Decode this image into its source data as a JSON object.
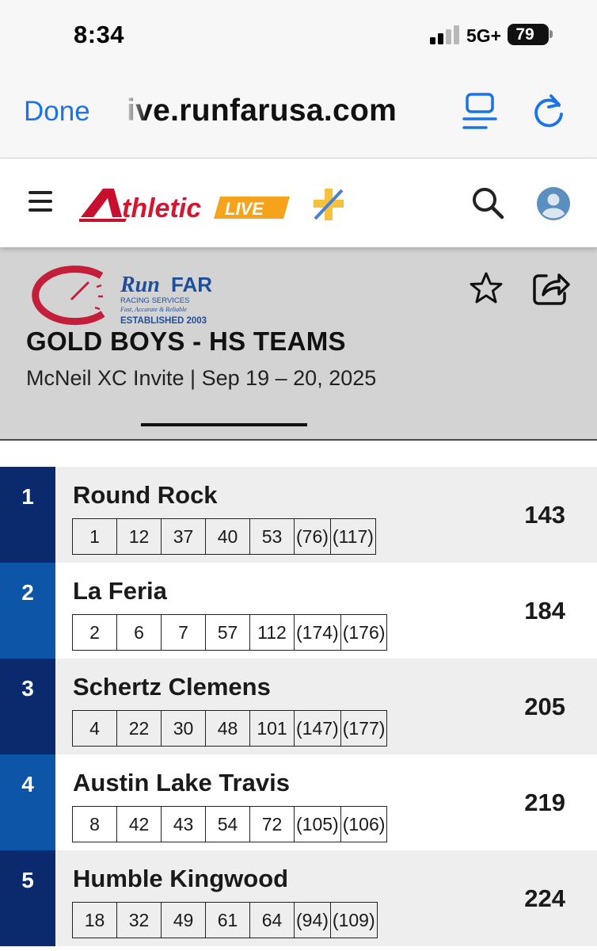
{
  "status_bar": {
    "time": "8:34",
    "network": "5G+",
    "battery": "79"
  },
  "browser": {
    "done_label": "Done",
    "url": "ive.runfarusa.com",
    "icons": {
      "reader": "reader-view-icon",
      "reload": "reload-icon"
    }
  },
  "site_header": {
    "logo_main": "thletic",
    "logo_badge": "LIVE",
    "icons": {
      "menu": "hamburger-menu-icon",
      "search": "search-icon",
      "account": "user-avatar-icon",
      "plus": "plus-icon"
    }
  },
  "meet": {
    "logo": {
      "name_run": "Run",
      "name_far": "FAR",
      "tagline": "RACING SERVICES",
      "motto": "Fast, Accurate & Reliable",
      "established": "ESTABLISHED 2003"
    },
    "event_title": "GOLD BOYS - HS TEAMS",
    "subtitle": "McNeil XC Invite | Sep 19 – 20, 2025",
    "icons": {
      "favorite": "star-icon",
      "share": "share-icon"
    }
  },
  "colors": {
    "rank_dark": "#0b2a6e",
    "rank_mid": "#0d55a6",
    "link_blue": "#1a73e8",
    "athletic_red": "#c8102e",
    "athletic_orange": "#f7a21b"
  },
  "results": [
    {
      "rank": "1",
      "team": "Round Rock",
      "scorers": [
        "1",
        "12",
        "37",
        "40",
        "53",
        "(76)",
        "(117)"
      ],
      "score": "143"
    },
    {
      "rank": "2",
      "team": "La Feria",
      "scorers": [
        "2",
        "6",
        "7",
        "57",
        "112",
        "(174)",
        "(176)"
      ],
      "score": "184"
    },
    {
      "rank": "3",
      "team": "Schertz Clemens",
      "scorers": [
        "4",
        "22",
        "30",
        "48",
        "101",
        "(147)",
        "(177)"
      ],
      "score": "205"
    },
    {
      "rank": "4",
      "team": "Austin Lake Travis",
      "scorers": [
        "8",
        "42",
        "43",
        "54",
        "72",
        "(105)",
        "(106)"
      ],
      "score": "219"
    },
    {
      "rank": "5",
      "team": "Humble Kingwood",
      "scorers": [
        "18",
        "32",
        "49",
        "61",
        "64",
        "(94)",
        "(109)"
      ],
      "score": "224"
    }
  ]
}
